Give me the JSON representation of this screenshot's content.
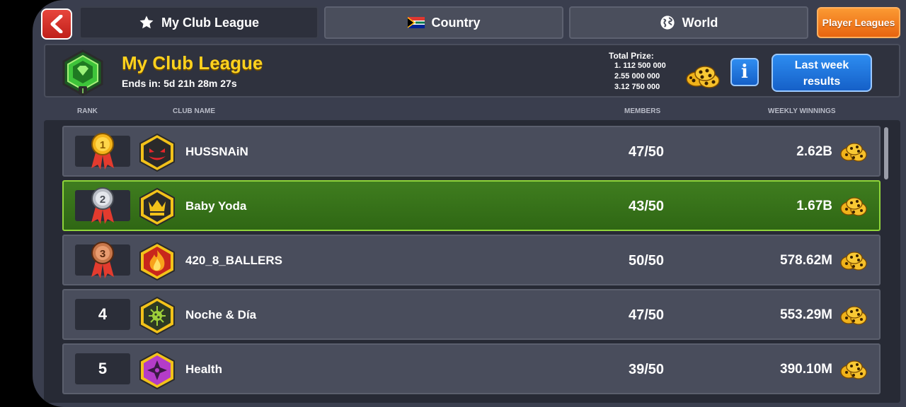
{
  "nav": {
    "tabs": [
      {
        "label": "My Club League",
        "icon": "star-icon"
      },
      {
        "label": "Country",
        "icon": "south-africa-flag-icon"
      },
      {
        "label": "World",
        "icon": "globe-icon"
      }
    ],
    "player_leagues": "Player Leagues"
  },
  "header": {
    "title": "My Club League",
    "ends_in": "Ends in: 5d 21h 28m 27s",
    "prize_title": "Total Prize:",
    "prizes": [
      "1. 112 500 000",
      "2.55 000 000",
      "3.12 750 000"
    ],
    "info": "i",
    "last_week_line1": "Last week",
    "last_week_line2": "results"
  },
  "columns": {
    "rank": "RANK",
    "club_name": "CLUB NAME",
    "members": "MEMBERS",
    "weekly_winnings": "WEEKLY WINNINGS"
  },
  "rows": [
    {
      "rank": "1",
      "medal": "gold",
      "name": "HUSSNAiN",
      "members": "47/50",
      "winnings": "2.62B",
      "badge": "devil-face-badge",
      "badge_color": "#2a2a2a"
    },
    {
      "rank": "2",
      "medal": "silver",
      "name": "Baby Yoda",
      "members": "43/50",
      "winnings": "1.67B",
      "badge": "crown-badge",
      "badge_color": "#2a2a2a"
    },
    {
      "rank": "3",
      "medal": "bronze",
      "name": "420_8_BALLERS",
      "members": "50/50",
      "winnings": "578.62M",
      "badge": "flame-badge",
      "badge_color": "#c8261c"
    },
    {
      "rank": "4",
      "medal": "",
      "name": "Noche & Día",
      "members": "47/50",
      "winnings": "553.29M",
      "badge": "virus-badge",
      "badge_color": "#2d3a24"
    },
    {
      "rank": "5",
      "medal": "",
      "name": "Health",
      "members": "39/50",
      "winnings": "390.10M",
      "badge": "shuriken-badge",
      "badge_color": "#b43cc8"
    }
  ],
  "colors": {
    "accent_yellow": "#ffd21e",
    "highlight_green": "#3f7d1f",
    "button_blue": "#1f78e0",
    "player_orange": "#f07d1e"
  }
}
